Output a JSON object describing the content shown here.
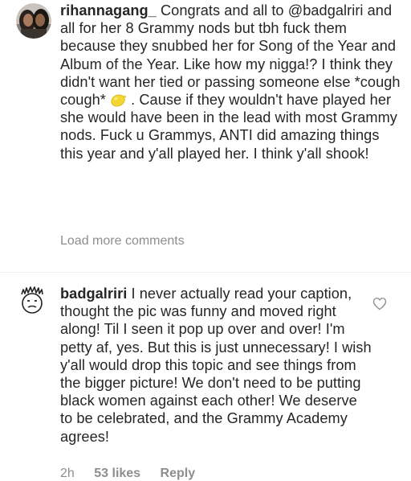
{
  "comments": [
    {
      "username": "rihannagang_",
      "text_before_emoji": "Congrats and all to @badgalriri and all for her 8 Grammy nods but tbh fuck them because they snubbed her for Song of the Year and Album of the Year. Like how my nigga!? I think they didn't want her tied or passing someone else *cough cough*",
      "emoji": "lemon-icon",
      "text_after_emoji": ". Cause if they wouldn't have played her she would have been in the lead with most Grammy nods. Fuck u Grammys, ANTI did amazing things this year and y'all played her. I think y'all shook!"
    },
    {
      "username": "badgalriri",
      "text": "I never actually read your caption, thought the pic was funny and moved right along! Til I seen it pop up over and over! I'm petty af, yes. But this is just unnecessary! I wish y'all would drop this topic and see things from the bigger picture! We don't need to be putting black women against each other! We deserve to be celebrated, and the Grammy Academy agrees!",
      "time": "2h",
      "likes": "53 likes",
      "reply_label": "Reply",
      "heart_icon": "heart-outline-icon"
    }
  ],
  "load_more_label": "Load more comments",
  "colors": {
    "text": "#262626",
    "muted": "#8e8e8e",
    "divider": "#efefef"
  }
}
